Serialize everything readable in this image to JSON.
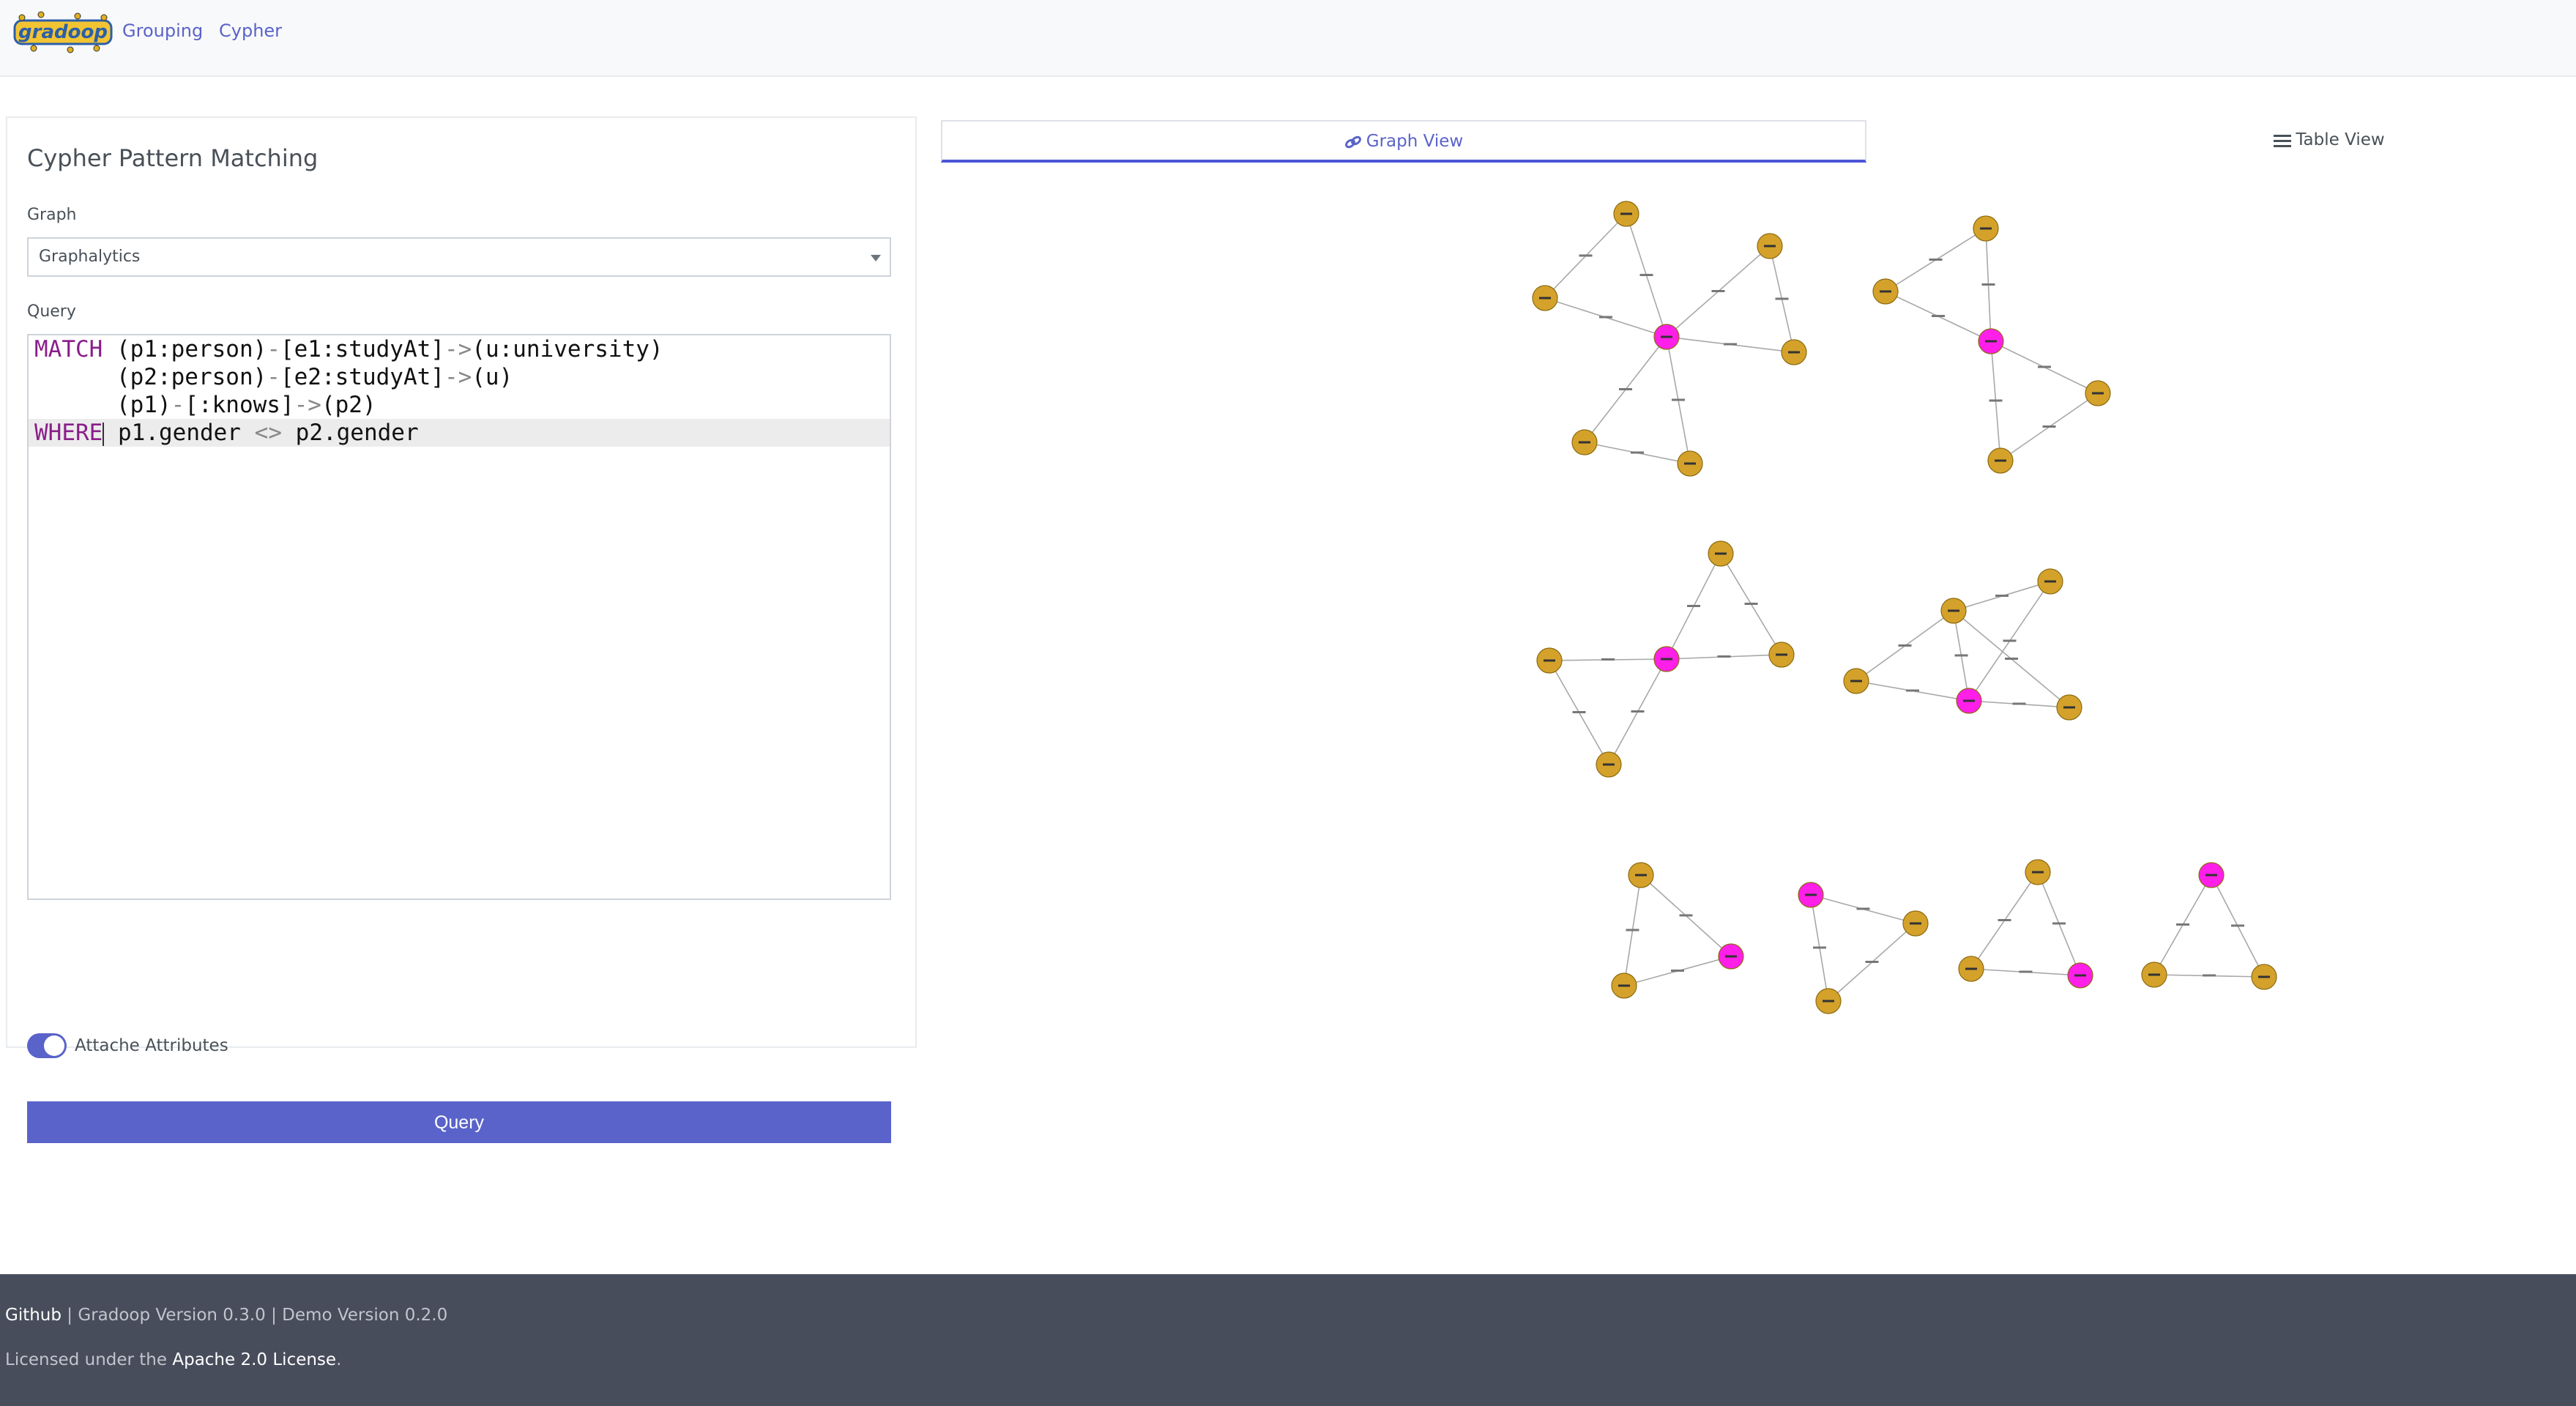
{
  "navbar": {
    "logo_text": "gradoop",
    "links": [
      "Grouping",
      "Cypher"
    ]
  },
  "panel": {
    "title": "Cypher Pattern Matching",
    "graph_label": "Graph",
    "graph_value": "Graphalytics",
    "query_label": "Query",
    "query_lines": [
      {
        "kw": "MATCH",
        "parts": [
          "(p1:person)",
          "-",
          "[e1:studyAt]",
          "->",
          "(u:university)"
        ]
      },
      {
        "kw": "",
        "parts": [
          "(p2:person)",
          "-",
          "[e2:studyAt]",
          "->",
          "(u)"
        ]
      },
      {
        "kw": "",
        "parts": [
          "(p1)",
          "-",
          "[:knows]",
          "->",
          "(p2)"
        ]
      },
      {
        "kw": "WHERE",
        "parts": [
          "p1.gender",
          "<>",
          "p2.gender"
        ]
      }
    ],
    "toggle_label": "Attache Attributes",
    "toggle_on": true,
    "query_button": "Query"
  },
  "tabs": {
    "graph_view": "Graph View",
    "table_view": "Table View"
  },
  "colors": {
    "person_node": "#d4a22b",
    "university_node": "#ff1fe8",
    "accent": "#5a63c9",
    "footer_bg": "#484d5c"
  },
  "footer": {
    "github": "Github",
    "versions": " | Gradoop Version 0.3.0 | Demo Version 0.2.0",
    "license_prefix": "Licensed under the ",
    "license_link": "Apache 2.0 License",
    "license_suffix": "."
  }
}
